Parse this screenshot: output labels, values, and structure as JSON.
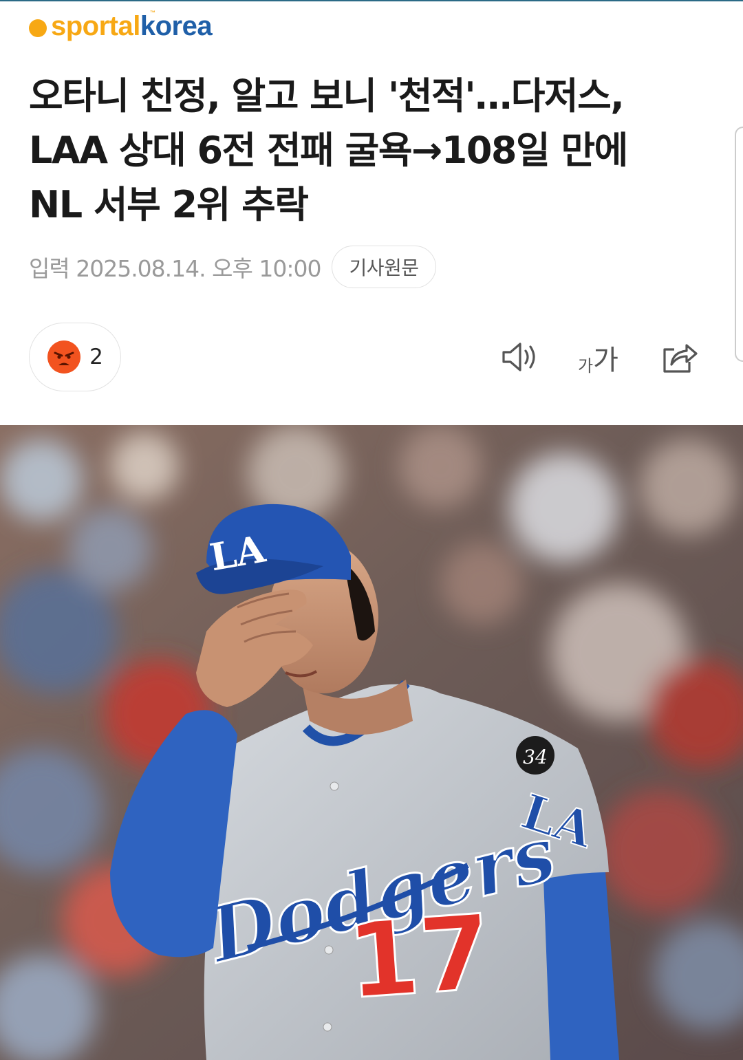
{
  "publisher": {
    "logo_part1": "sportal",
    "logo_part2": "korea",
    "logo_tm": "™",
    "colors": {
      "orange": "#f7a814",
      "blue": "#1f5fa8"
    }
  },
  "article": {
    "headline_lines": [
      "오타니 친정, 알고 보니 '천적'…다저스,",
      "LAA 상대 6전 전패 굴욕→108일 만에",
      "NL 서부 2위 추락"
    ],
    "date": "입력 2025.08.14. 오후 10:00",
    "source_label": "기사원문"
  },
  "actions": {
    "reaction_icon": "angry-face-icon",
    "reaction_count": "2",
    "tts_icon": "speaker-icon",
    "font_size_small": "가",
    "font_size_large": "가",
    "share_icon": "share-icon"
  },
  "photo": {
    "jersey_text": "Dodgers",
    "cap_logo": "LA",
    "sleeve_logo": "LA",
    "number": "17",
    "patch": "34"
  }
}
